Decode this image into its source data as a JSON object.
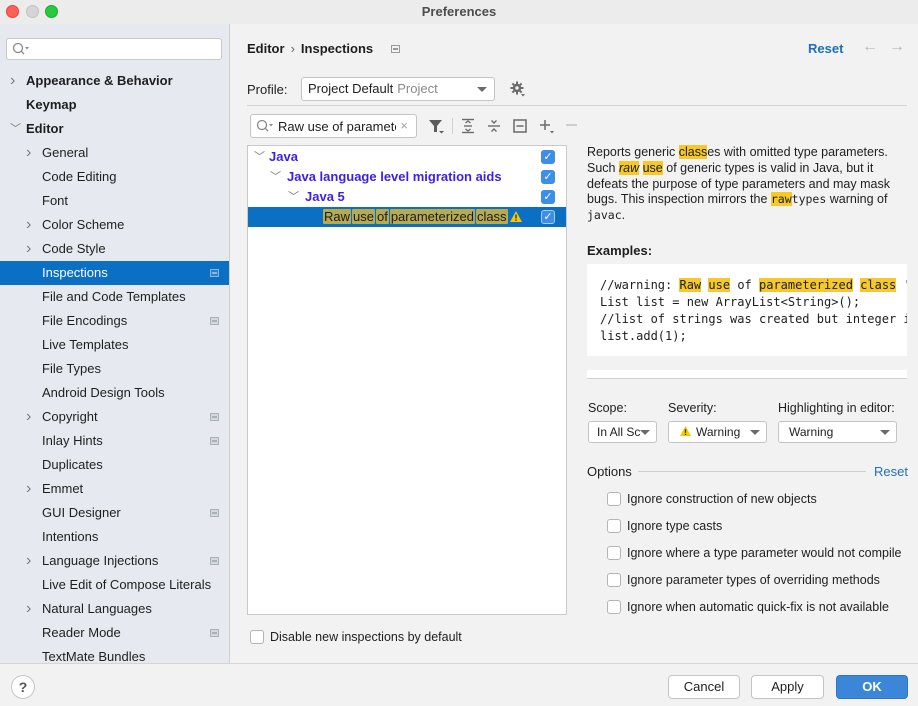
{
  "window": {
    "title": "Preferences"
  },
  "sidebar": {
    "search_placeholder": "",
    "items": [
      {
        "label": "Appearance & Behavior",
        "level": 0,
        "bold": true,
        "chevron": "right"
      },
      {
        "label": "Keymap",
        "level": 0,
        "bold": true,
        "chevron": "none"
      },
      {
        "label": "Editor",
        "level": 0,
        "bold": true,
        "chevron": "down"
      },
      {
        "label": "General",
        "level": 1,
        "chevron": "right"
      },
      {
        "label": "Code Editing",
        "level": 1,
        "chevron": "none"
      },
      {
        "label": "Font",
        "level": 1,
        "chevron": "none"
      },
      {
        "label": "Color Scheme",
        "level": 1,
        "chevron": "right"
      },
      {
        "label": "Code Style",
        "level": 1,
        "chevron": "right"
      },
      {
        "label": "Inspections",
        "level": 1,
        "chevron": "none",
        "selected": true,
        "project_icon": true
      },
      {
        "label": "File and Code Templates",
        "level": 1,
        "chevron": "none"
      },
      {
        "label": "File Encodings",
        "level": 1,
        "chevron": "none",
        "project_icon": true
      },
      {
        "label": "Live Templates",
        "level": 1,
        "chevron": "none"
      },
      {
        "label": "File Types",
        "level": 1,
        "chevron": "none"
      },
      {
        "label": "Android Design Tools",
        "level": 1,
        "chevron": "none"
      },
      {
        "label": "Copyright",
        "level": 1,
        "chevron": "right",
        "project_icon": true
      },
      {
        "label": "Inlay Hints",
        "level": 1,
        "chevron": "none",
        "project_icon": true
      },
      {
        "label": "Duplicates",
        "level": 1,
        "chevron": "none"
      },
      {
        "label": "Emmet",
        "level": 1,
        "chevron": "right"
      },
      {
        "label": "GUI Designer",
        "level": 1,
        "chevron": "none",
        "project_icon": true
      },
      {
        "label": "Intentions",
        "level": 1,
        "chevron": "none"
      },
      {
        "label": "Language Injections",
        "level": 1,
        "chevron": "right",
        "project_icon": true
      },
      {
        "label": "Live Edit of Compose Literals",
        "level": 1,
        "chevron": "none"
      },
      {
        "label": "Natural Languages",
        "level": 1,
        "chevron": "right"
      },
      {
        "label": "Reader Mode",
        "level": 1,
        "chevron": "none",
        "project_icon": true
      },
      {
        "label": "TextMate Bundles",
        "level": 1,
        "chevron": "none"
      }
    ]
  },
  "header": {
    "breadcrumb": [
      "Editor",
      "Inspections"
    ],
    "reset_label": "Reset",
    "back_icon": "arrow-left-icon",
    "forward_icon": "arrow-right-icon"
  },
  "profile": {
    "label": "Profile:",
    "value": "Project Default",
    "value_sub": "Project"
  },
  "filter": {
    "value": "Raw use of paramete",
    "clear_icon": "×"
  },
  "tree": {
    "rows": [
      {
        "label": "Java",
        "level": 0,
        "checked": true
      },
      {
        "label": "Java language level migration aids",
        "level": 1,
        "checked": true
      },
      {
        "label": "Java 5",
        "level": 2,
        "checked": true
      },
      {
        "words": [
          "Raw",
          "use",
          "of",
          "parameterized",
          "class"
        ],
        "level": 3,
        "checked": true,
        "selected": true,
        "severity_icon": "warning-icon"
      }
    ]
  },
  "description": {
    "p1_a": "Reports generic ",
    "p1_hl1": "class",
    "p1_b": "es with omitted type parameters. Such ",
    "p1_hl2": "raw",
    "p1_c": " ",
    "p1_hl3": "use",
    "p1_d": " of generic types is valid in Java, but it defeats the purpose of type parameters and may mask bugs. This inspection mirrors the ",
    "p1_hl4": "raw",
    "p1_e": "types",
    "p1_f": " warning of ",
    "p1_g": "javac",
    "p1_h": ".",
    "examples_label": "Examples:",
    "code": {
      "l1_a": "//warning: ",
      "l1_hl1": "Raw",
      "l1_sp1": " ",
      "l1_hl2": "use",
      "l1_b": " of ",
      "l1_hl3": "parameterized",
      "l1_sp2": " ",
      "l1_hl4": "class",
      "l1_c": " 'L",
      "l2": "List list = new ArrayList<String>();",
      "l3": "//list of strings was created but integer is",
      "l4": "list.add(1);"
    }
  },
  "settings": {
    "scope_label": "Scope:",
    "scope_value": "In All Sc",
    "severity_label": "Severity:",
    "severity_value": "Warning",
    "highlighting_label": "Highlighting in editor:",
    "highlighting_value": "Warning"
  },
  "options": {
    "label": "Options",
    "reset_label": "Reset",
    "items": [
      {
        "label": "Ignore construction of new objects",
        "checked": false
      },
      {
        "label": "Ignore type casts",
        "checked": false
      },
      {
        "label": "Ignore where a type parameter would not compile",
        "checked": false
      },
      {
        "label": "Ignore parameter types of overriding methods",
        "checked": false
      },
      {
        "label": "Ignore when automatic quick-fix is not available",
        "checked": false
      }
    ]
  },
  "disable_new": {
    "label": "Disable new inspections by default",
    "checked": false
  },
  "footer": {
    "help_label": "?",
    "cancel_label": "Cancel",
    "apply_label": "Apply",
    "ok_label": "OK"
  }
}
